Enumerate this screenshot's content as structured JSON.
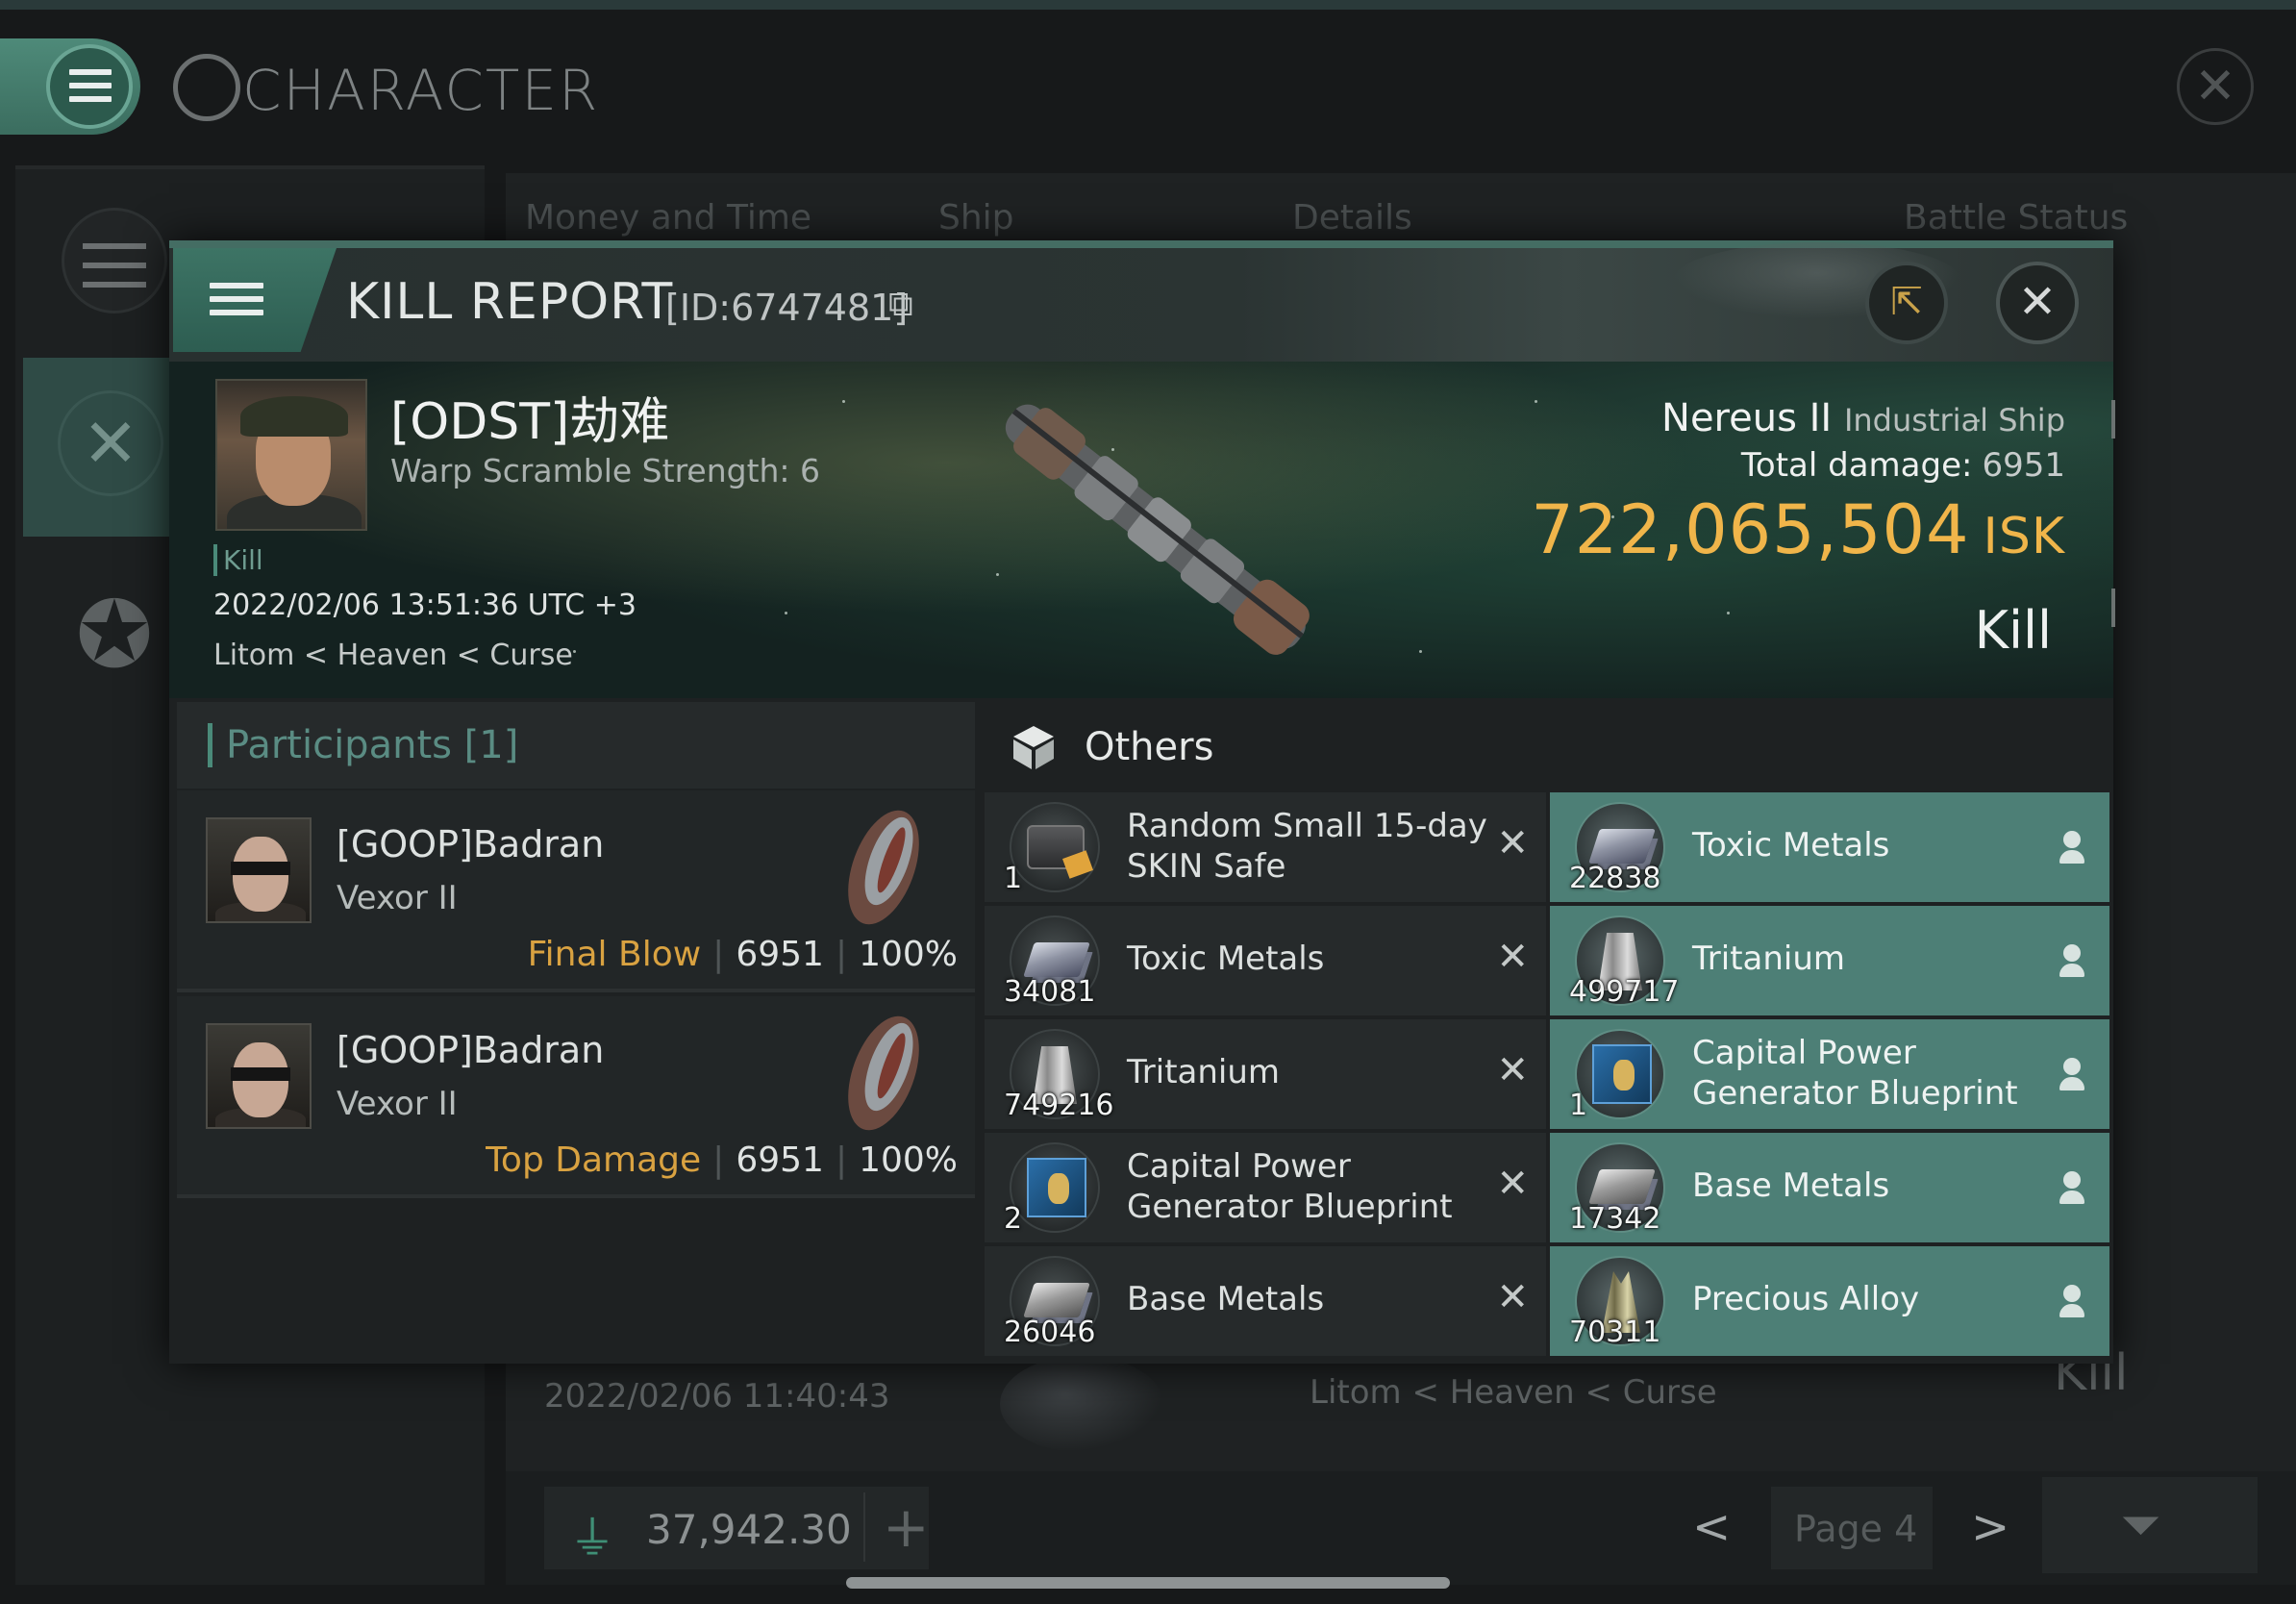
{
  "background": {
    "title": "CHARACTER",
    "tabs": [
      "Money and Time",
      "Ship",
      "Details",
      "Battle Status"
    ],
    "row": {
      "date": "2022/02/06 11:40:43",
      "location": "Litom < Heaven < Curse",
      "result": "Kill"
    },
    "wallet": {
      "value": "37,942.30",
      "add_label": "+"
    },
    "pager": {
      "prev": "<",
      "label": "Page 4",
      "next": ">"
    }
  },
  "kill_report": {
    "title": "KILL REPORT",
    "id": "[ID:6747481]",
    "victim": {
      "name": "[ODST]劫难",
      "warp_scramble": "Warp Scramble Strength: 6",
      "tag": "Kill",
      "time": "2022/02/06 13:51:36 UTC +3",
      "location": "Litom < Heaven < Curse",
      "ship_name": "Nereus II",
      "ship_class": "Industrial Ship",
      "total_damage_label": "Total damage:",
      "total_damage": "6951",
      "isk": "722,065,504",
      "isk_unit": "ISK",
      "result": "Kill"
    },
    "participants": {
      "title": "Participants [1]",
      "items": [
        {
          "name": "[GOOP]Badran",
          "ship": "Vexor II",
          "tag": "Final Blow",
          "damage": "6951",
          "percent": "100%"
        },
        {
          "name": "[GOOP]Badran",
          "ship": "Vexor II",
          "tag": "Top Damage",
          "damage": "6951",
          "percent": "100%"
        }
      ]
    },
    "others": {
      "title": "Others",
      "destroyed": [
        {
          "qty": "1",
          "name": "Random Small 15-day SKIN Safe",
          "icon": "skin-safe"
        },
        {
          "qty": "34081",
          "name": "Toxic Metals",
          "icon": "toxic-metals"
        },
        {
          "qty": "749216",
          "name": "Tritanium",
          "icon": "tritanium"
        },
        {
          "qty": "2",
          "name": "Capital Power Generator Blueprint",
          "icon": "blueprint"
        },
        {
          "qty": "26046",
          "name": "Base Metals",
          "icon": "base-metals"
        }
      ],
      "dropped": [
        {
          "qty": "22838",
          "name": "Toxic Metals",
          "icon": "toxic-metals"
        },
        {
          "qty": "499717",
          "name": "Tritanium",
          "icon": "tritanium"
        },
        {
          "qty": "1",
          "name": "Capital Power Generator Blueprint",
          "icon": "blueprint"
        },
        {
          "qty": "17342",
          "name": "Base Metals",
          "icon": "base-metals"
        },
        {
          "qty": "70311",
          "name": "Precious Alloy",
          "icon": "precious-alloy"
        }
      ]
    }
  },
  "colors": {
    "accent": "#4d7f76",
    "isk": "#f0b54a",
    "tag": "#d9a241"
  }
}
